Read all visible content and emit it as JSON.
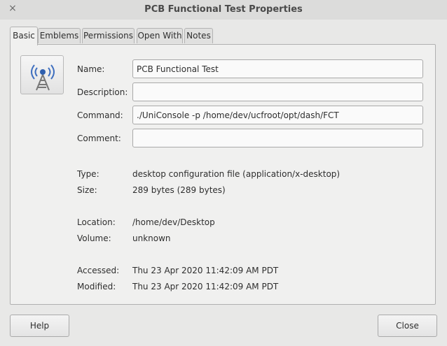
{
  "window": {
    "title": "PCB Functional Test Properties",
    "close_glyph": "×"
  },
  "tabs": [
    {
      "label": "Basic"
    },
    {
      "label": "Emblems"
    },
    {
      "label": "Permissions"
    },
    {
      "label": "Open With"
    },
    {
      "label": "Notes"
    }
  ],
  "basic": {
    "icon": "radio-tower-icon",
    "name_label": "Name:",
    "name_value": "PCB Functional Test",
    "description_label": "Description:",
    "description_value": "",
    "command_label": "Command:",
    "command_value": "./UniConsole -p /home/dev/ucfroot/opt/dash/FCT",
    "comment_label": "Comment:",
    "comment_value": "",
    "type_label": "Type:",
    "type_value": "desktop configuration file (application/x-desktop)",
    "size_label": "Size:",
    "size_value": "289 bytes (289 bytes)",
    "location_label": "Location:",
    "location_value": "/home/dev/Desktop",
    "volume_label": "Volume:",
    "volume_value": "unknown",
    "accessed_label": "Accessed:",
    "accessed_value": "Thu 23 Apr 2020 11:42:09 AM PDT",
    "modified_label": "Modified:",
    "modified_value": "Thu 23 Apr 2020 11:42:09 AM PDT"
  },
  "buttons": {
    "help": "Help",
    "close": "Close"
  }
}
